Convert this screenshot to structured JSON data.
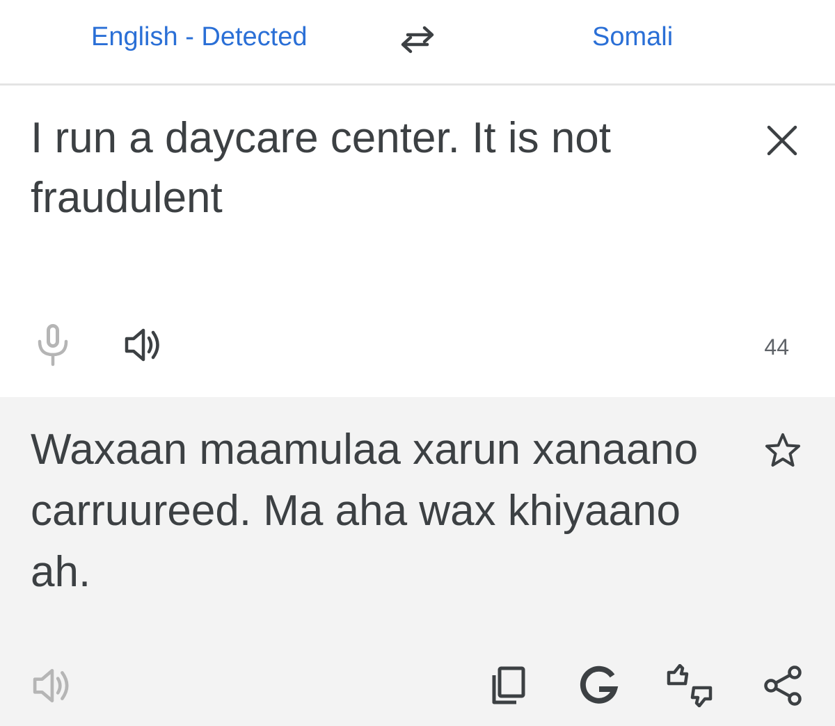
{
  "language_bar": {
    "source_language": "English - Detected",
    "target_language": "Somali",
    "swap_icon": "swap-arrows-icon"
  },
  "source": {
    "text": "I run a daycare center. It is not fraudulent",
    "char_count": "44",
    "icons": [
      "close-icon",
      "microphone-icon",
      "speaker-icon"
    ]
  },
  "result": {
    "text": "Waxaan maamulaa xarun xanaano carruureed. Ma aha wax khiyaano ah.",
    "icons": [
      "star-icon",
      "speaker-icon",
      "copy-icon",
      "google-icon",
      "feedback-icon",
      "share-icon"
    ]
  },
  "colors": {
    "accent": "#2a6fd6",
    "text": "#3c4043",
    "muted_icon": "#b0b0b0",
    "result_background": "#f3f3f3"
  }
}
